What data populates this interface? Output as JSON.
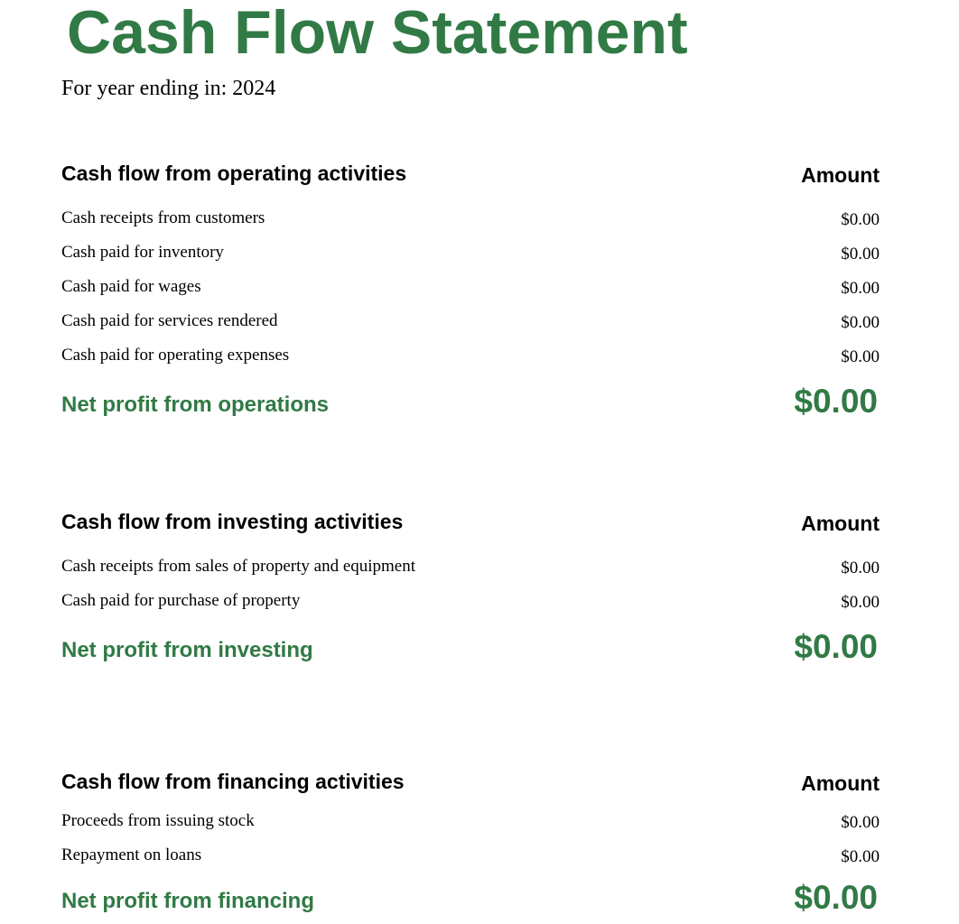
{
  "document": {
    "title": "Cash Flow Statement",
    "subtitle": "For year ending in: 2024",
    "accent_color": "#317a45"
  },
  "sections": [
    {
      "title": "Cash flow from operating activities",
      "amount_header": "Amount",
      "rows": [
        {
          "label": "Cash receipts from customers",
          "value": "$0.00"
        },
        {
          "label": "Cash paid for inventory",
          "value": "$0.00"
        },
        {
          "label": "Cash paid for wages",
          "value": "$0.00"
        },
        {
          "label": "Cash paid for services rendered",
          "value": "$0.00"
        },
        {
          "label": "Cash paid for operating expenses",
          "value": "$0.00"
        }
      ],
      "total_label": "Net profit from operations",
      "total_value": "$0.00"
    },
    {
      "title": "Cash flow from investing activities",
      "amount_header": "Amount",
      "rows": [
        {
          "label": "Cash receipts from sales of property and equipment",
          "value": "$0.00"
        },
        {
          "label": "Cash paid for purchase of property",
          "value": "$0.00"
        }
      ],
      "total_label": "Net profit from investing",
      "total_value": "$0.00"
    },
    {
      "title": "Cash flow from financing activities",
      "amount_header": "Amount",
      "rows": [
        {
          "label": "Proceeds from issuing stock",
          "value": "$0.00"
        },
        {
          "label": "Repayment on loans",
          "value": "$0.00"
        }
      ],
      "total_label": "Net profit from financing",
      "total_value": "$0.00"
    }
  ]
}
